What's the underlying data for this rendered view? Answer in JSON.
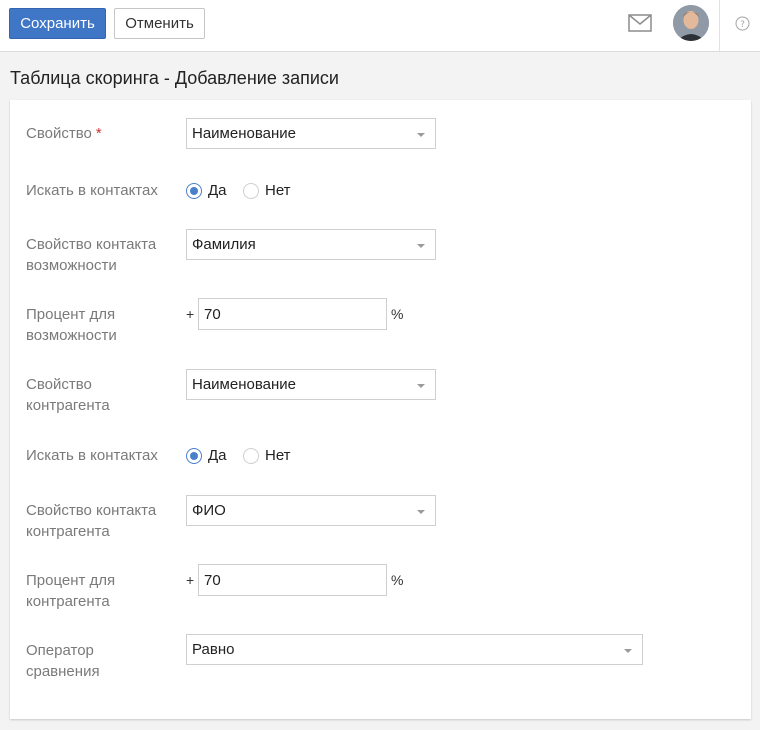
{
  "toolbar": {
    "save_label": "Сохранить",
    "cancel_label": "Отменить"
  },
  "header": {
    "title": "Таблица скоринга - Добавление записи"
  },
  "form": {
    "property": {
      "label": "Свойство",
      "required_mark": "*",
      "value": "Наименование"
    },
    "search1": {
      "label": "Искать в контактах",
      "yes": "Да",
      "no": "Нет",
      "selected": "yes"
    },
    "opp_contact_property": {
      "label": "Свойство контакта возможности",
      "value": "Фамилия"
    },
    "opp_percent": {
      "label": "Процент для возможности",
      "plus": "+",
      "value": "70",
      "unit": "%"
    },
    "account_property": {
      "label": "Свойство контрагента",
      "value": "Наименование"
    },
    "search2": {
      "label": "Искать в контактах",
      "yes": "Да",
      "no": "Нет",
      "selected": "yes"
    },
    "account_contact_property": {
      "label": "Свойство контакта контрагента",
      "value": "ФИО"
    },
    "account_percent": {
      "label": "Процент для контрагента",
      "plus": "+",
      "value": "70",
      "unit": "%"
    },
    "operator": {
      "label": "Оператор сравнения",
      "value": "Равно"
    }
  },
  "colors": {
    "accent": "#3f76c6",
    "required": "#d0312d",
    "label": "#7a7a7a"
  },
  "icons": {
    "mail": "mail-icon",
    "help": "help-icon"
  }
}
